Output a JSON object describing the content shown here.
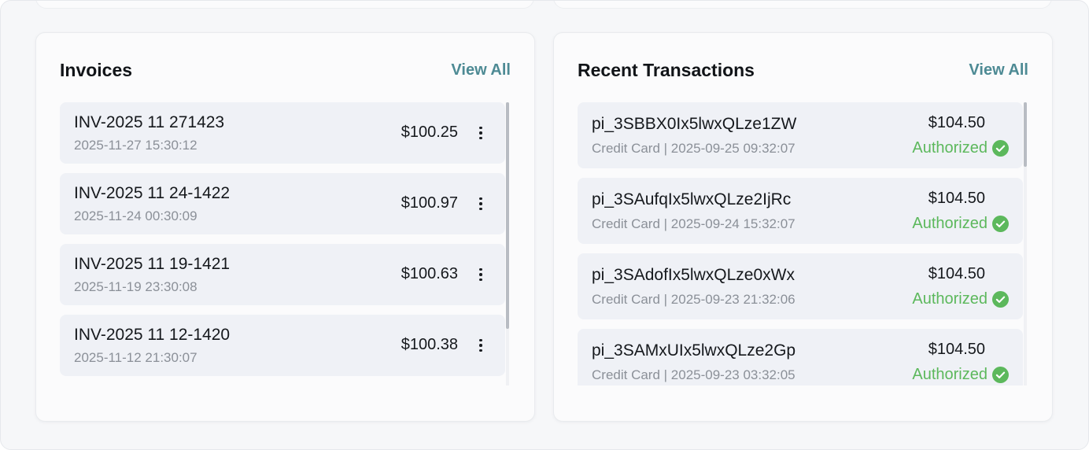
{
  "invoices": {
    "title": "Invoices",
    "view_all": "View All",
    "items": [
      {
        "number": "INV-2025 11 271423",
        "date": "2025-11-27 15:30:12",
        "amount": "$100.25"
      },
      {
        "number": "INV-2025 11 24-1422",
        "date": "2025-11-24 00:30:09",
        "amount": "$100.97"
      },
      {
        "number": "INV-2025 11 19-1421",
        "date": "2025-11-19 23:30:08",
        "amount": "$100.63"
      },
      {
        "number": "INV-2025 11 12-1420",
        "date": "2025-11-12 21:30:07",
        "amount": "$100.38"
      }
    ]
  },
  "transactions": {
    "title": "Recent Transactions",
    "view_all": "View All",
    "items": [
      {
        "id": "pi_3SBBX0Ix5lwxQLze1ZW",
        "meta": "Credit Card | 2025-09-25 09:32:07",
        "amount": "$104.50",
        "status": "Authorized"
      },
      {
        "id": "pi_3SAufqIx5lwxQLze2IjRc",
        "meta": "Credit Card | 2025-09-24 15:32:07",
        "amount": "$104.50",
        "status": "Authorized"
      },
      {
        "id": "pi_3SAdofIx5lwxQLze0xWx",
        "meta": "Credit Card | 2025-09-23 21:32:06",
        "amount": "$104.50",
        "status": "Authorized"
      },
      {
        "id": "pi_3SAMxUIx5lwxQLze2Gp",
        "meta": "Credit Card | 2025-09-23 03:32:05",
        "amount": "$104.50",
        "status": "Authorized"
      }
    ]
  },
  "colors": {
    "accent": "#4d8a94",
    "success": "#5cb85c",
    "row_background": "#eff1f6"
  },
  "icons": {
    "row_menu": "kebab-menu-icon",
    "status": "check-circle-icon"
  }
}
